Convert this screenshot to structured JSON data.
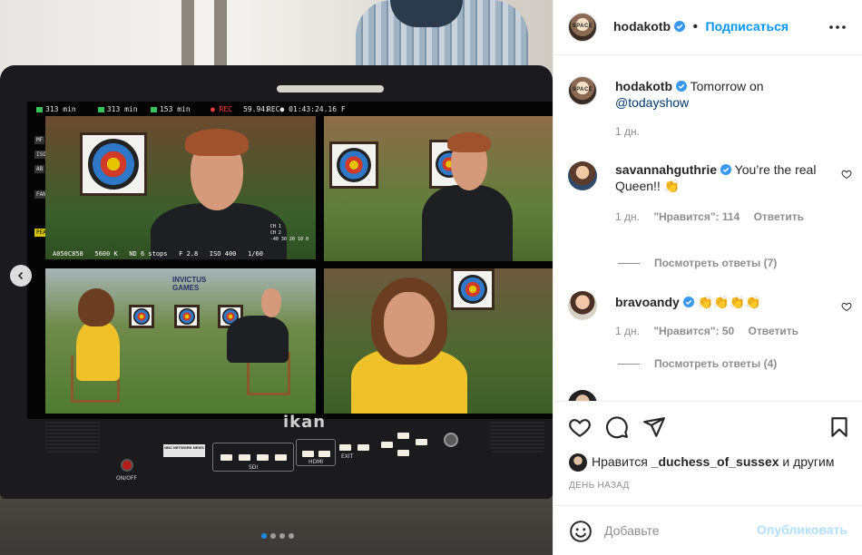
{
  "post_image": {
    "osd_top": {
      "ch1_min": "313 min",
      "ch2_min": "313 min",
      "ch3_min": "153 min",
      "rec_label": "REC",
      "framerate": "59.94i",
      "timecode": "REC● 01:43:24.16 F"
    },
    "side_tags": [
      "MF",
      "ISO",
      "AB",
      "FAN",
      "PEAK1"
    ],
    "q1_osd": {
      "clip": "A050C858",
      "wb": "5600 K",
      "nd": "ND 6 stops",
      "fstop": "F 2.8",
      "iso": "ISO 400",
      "shutter": "1/60",
      "meter_line1": "CH 1",
      "meter_line2": "CH 2",
      "meter_scale": "-40 30 20 10 0"
    },
    "invictus_line1": "INVICTUS",
    "invictus_line2": "GAMES",
    "brand": "ikan",
    "onoff_label": "ON/OFF",
    "nbc_badge": "NBC NETWORK NEWS",
    "sdi_label": "SDI",
    "hdmi_label": "HDMI",
    "exit_label": "EXIT",
    "menu_label": "MENU",
    "sdi_numbers": [
      "1",
      "2",
      "3",
      "4"
    ],
    "hdmi_numbers": [
      "1",
      "2"
    ],
    "fn_labels": [
      "F1",
      "F2",
      "F3",
      "F4",
      "F5",
      "F6"
    ],
    "carousel": {
      "total": 4,
      "active": 0
    }
  },
  "header": {
    "username": "hodakotb",
    "separator": "•",
    "follow": "Подписаться",
    "avatar_text": "SPACE"
  },
  "caption": {
    "username": "hodakotb",
    "text": "Tomorrow on",
    "mention": "@todayshow",
    "time": "1 дн."
  },
  "comments": [
    {
      "username": "savannahguthrie",
      "text": "You’re the real Queen!! 👏",
      "time": "1 дн.",
      "likes": "\"Нравится\": 114",
      "reply": "Ответить",
      "view_replies": "Посмотреть ответы (7)"
    },
    {
      "username": "bravoandy",
      "text": "👏👏👏👏",
      "time": "1 дн.",
      "likes": "\"Нравится\": 50",
      "reply": "Ответить",
      "view_replies": "Посмотреть ответы (4)"
    }
  ],
  "actions": {
    "icons": [
      "heart-icon",
      "comment-icon",
      "share-icon",
      "bookmark-icon"
    ],
    "likes_prefix": "Нравится",
    "likes_user": "_duchess_of_sussex",
    "likes_suffix": "и другим",
    "date": "ДЕНЬ НАЗАД"
  },
  "add_comment": {
    "placeholder": "Добавьте",
    "publish": "Опубликовать"
  },
  "colors": {
    "accent": "#0095f6",
    "verified": "#3897f0",
    "muted": "#8e8e8e",
    "publish_disabled": "#b2dffc"
  }
}
